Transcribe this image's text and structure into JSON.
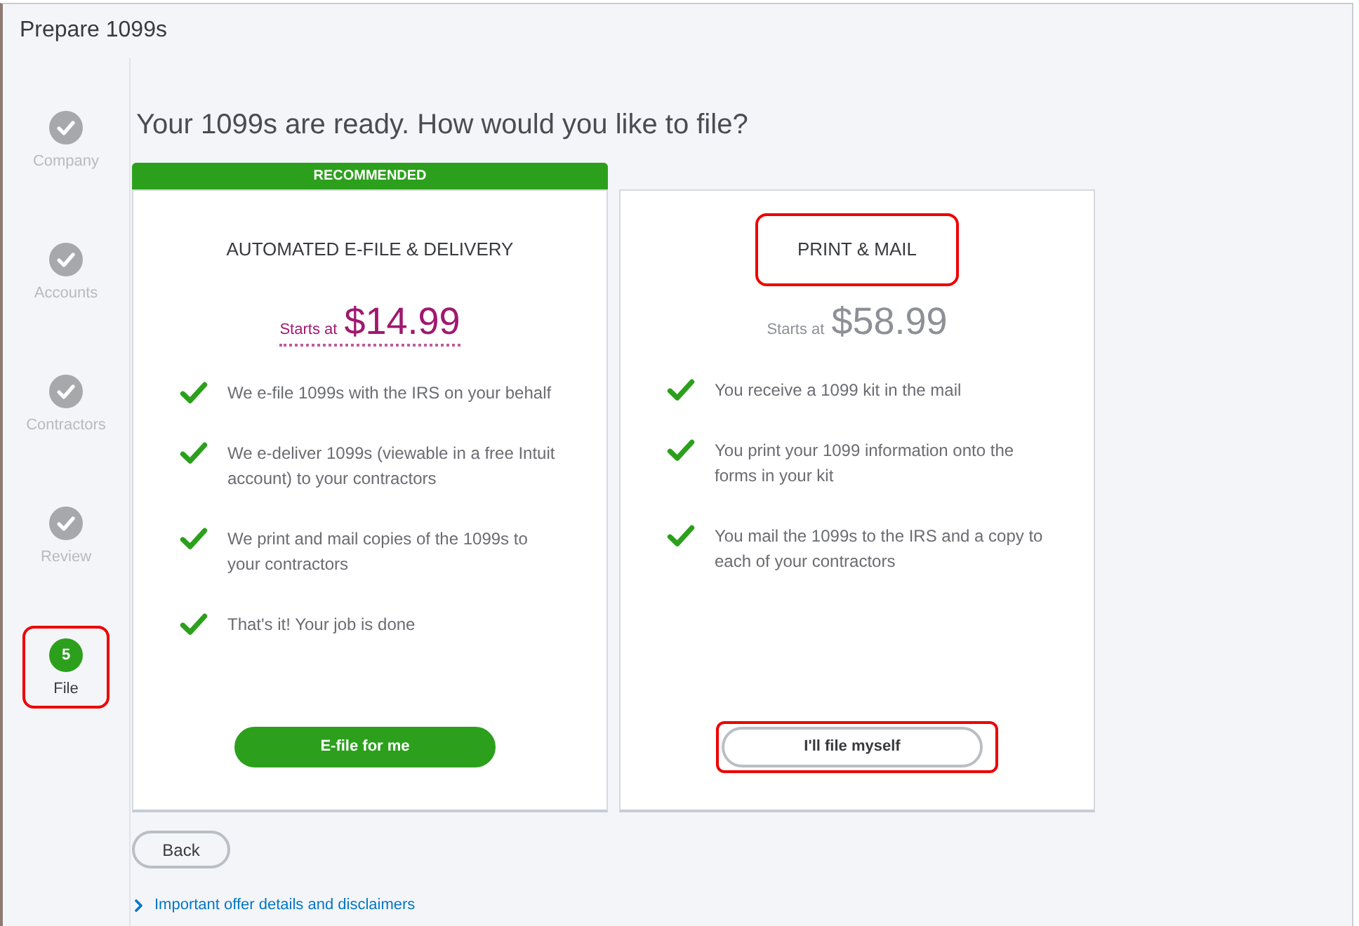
{
  "window": {
    "title": "Prepare 1099s"
  },
  "steps": [
    {
      "label": "Company",
      "completed": true,
      "highlighted": false
    },
    {
      "label": "Accounts",
      "completed": true,
      "highlighted": false
    },
    {
      "label": "Contractors",
      "completed": true,
      "highlighted": false
    },
    {
      "label": "Review",
      "completed": true,
      "highlighted": false
    },
    {
      "label": "File",
      "number": "5",
      "completed": false,
      "highlighted": true
    }
  ],
  "heading": "Your 1099s are ready. How would you like to file?",
  "plans": [
    {
      "badge": "RECOMMENDED",
      "title": "AUTOMATED E-FILE & DELIVERY",
      "title_highlighted": false,
      "featured": true,
      "price_prefix": "Starts at",
      "price": "$14.99",
      "features": [
        "We e-file 1099s with the IRS on your behalf",
        "We e-deliver 1099s (viewable in a free Intuit account) to your contractors",
        "We print and mail copies of the 1099s to your contractors",
        "That's it! Your job is done"
      ],
      "button": {
        "label": "E-file for me",
        "kind": "primary",
        "highlighted": false
      }
    },
    {
      "title": "PRINT & MAIL",
      "title_highlighted": true,
      "featured": false,
      "price_prefix": "Starts at",
      "price": "$58.99",
      "features": [
        "You receive a 1099 kit in the mail",
        "You print your 1099 information onto the forms in your kit",
        "You mail the 1099s to the IRS and a copy to each of your contractors"
      ],
      "button": {
        "label": "I'll file myself",
        "kind": "secondary",
        "highlighted": true
      }
    }
  ],
  "back_button": {
    "label": "Back"
  },
  "disclosure": {
    "label": "Important offer details and disclaimers",
    "expanded": false
  }
}
